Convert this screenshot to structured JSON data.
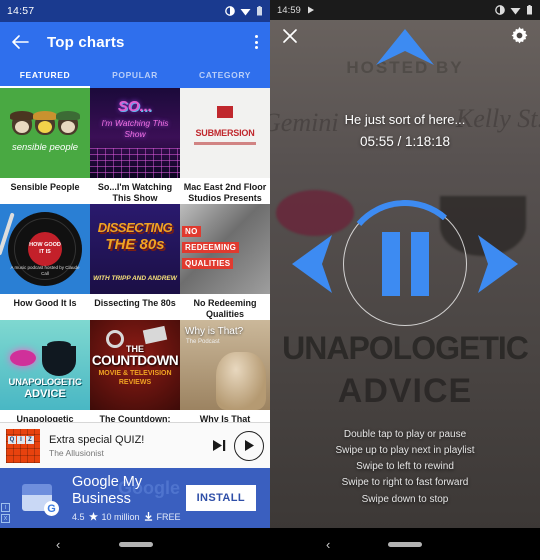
{
  "left": {
    "statusbar": {
      "clock": "14:57",
      "icons": [
        "dnd-icon",
        "wifi-icon",
        "battery-icon"
      ]
    },
    "appbar": {
      "back_icon": "back-arrow-icon",
      "title": "Top charts",
      "overflow_icon": "overflow-menu-icon"
    },
    "tabs": [
      {
        "label": "FEATURED",
        "active": true
      },
      {
        "label": "POPULAR",
        "active": false
      },
      {
        "label": "CATEGORY",
        "active": false
      }
    ],
    "grid": [
      {
        "caption": "Sensible People",
        "art_text": "sensible people"
      },
      {
        "caption": "So...I'm Watching This Show",
        "art_text": "SO...",
        "art_sub": "I'm Watching This Show"
      },
      {
        "caption": "Mac East 2nd Floor Studios Presents",
        "art_text": "SUBMERSION"
      },
      {
        "caption": "How Good It Is",
        "art_text": "HOW GOOD IT IS",
        "art_sub": "A music podcast hosted by Claude Call"
      },
      {
        "caption": "Dissecting The 80s",
        "art_text": "DISSECTING",
        "art_sub": "THE 80s",
        "art_sub2": "WITH TRIPP AND ANDREW"
      },
      {
        "caption": "No Redeeming Qualities",
        "art_text": "NO",
        "art_sub": "REDEEMING",
        "art_sub2": "QUALITIES"
      },
      {
        "caption": "Unapologetic Advice",
        "art_text": "UNAPOLOGETIC",
        "art_sub": "ADVICE"
      },
      {
        "caption": "The Countdown:",
        "art_text": "THE",
        "art_sub": "COUNTDOWN",
        "art_sub2": "MOVIE & TELEVISION",
        "art_sub3": "REVIEWS"
      },
      {
        "caption": "Why Is That Podcast",
        "art_text": "Why is That?",
        "art_sub": "The Podcast"
      }
    ],
    "player": {
      "thumb_letters": [
        "Q",
        "I",
        "Z"
      ],
      "title": "Extra special QUIZ!",
      "subtitle": "The Allusionist",
      "next_icon": "skip-next-icon",
      "play_icon": "play-icon"
    },
    "ad": {
      "ghost_text": "Google",
      "title_line1": "Google My",
      "title_line2": "Business",
      "rating": "4.5",
      "star_icon": "star-icon",
      "downloads": "10 million",
      "download_icon": "download-icon",
      "price": "FREE",
      "install_label": "INSTALL",
      "info_mark": "i",
      "close_mark": "x",
      "accent": "#3a5fbf"
    },
    "navbar": {
      "back_icon": "nav-back-icon",
      "pill": "home-pill"
    }
  },
  "right": {
    "statusbar": {
      "clock": "14:59",
      "play_indicator": "play-indicator-icon",
      "icons": [
        "dnd-icon",
        "wifi-icon",
        "battery-icon"
      ]
    },
    "top": {
      "close_icon": "close-icon",
      "settings_icon": "gear-icon",
      "chevron_icon": "chevron-up-icon"
    },
    "background": {
      "hosted_by": "HOSTED BY",
      "script_left": "Gemini",
      "script_right": "Kelly St.",
      "big_line1": "UNAPOLOGETIC",
      "big_line2": "ADVICE"
    },
    "now_playing": {
      "title": "He just sort of here...",
      "elapsed": "05:55",
      "separator": "/",
      "duration": "1:18:18",
      "time_display": "05:55 / 1:18:18",
      "state": "playing",
      "pause_icon": "pause-icon",
      "prev_icon": "rewind-arrow-icon",
      "next_icon": "forward-arrow-icon",
      "accent": "#3d8bf2",
      "progress_percent": 7
    },
    "hints": [
      "Double tap to play or pause",
      "Swipe up to play next in playlist",
      "Swipe to left to rewind",
      "Swipe to right to fast forward",
      "Swipe down to stop"
    ],
    "navbar": {
      "back_icon": "nav-back-icon",
      "pill": "home-pill"
    }
  }
}
